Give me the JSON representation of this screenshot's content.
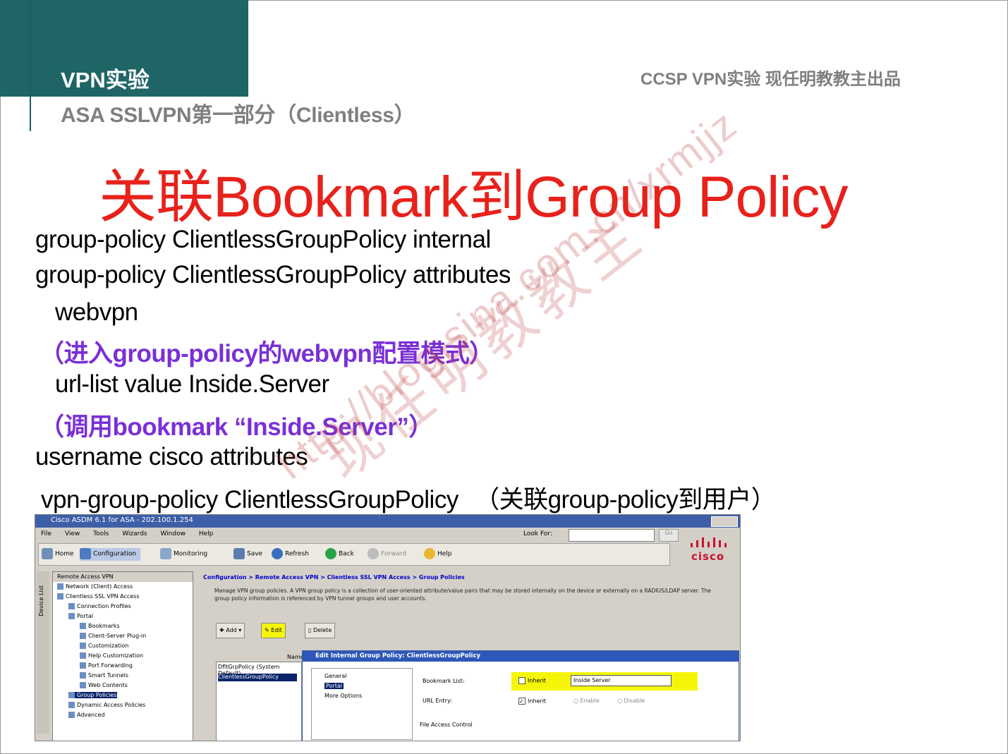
{
  "header": {
    "title": "VPN实验",
    "subtitle": "ASA SSLVPN第一部分（Clientless）",
    "right": "CCSP VPN实验  现任明教教主出品"
  },
  "main_title": "关联Bookmark到Group Policy",
  "lines": {
    "l1": "group-policy ClientlessGroupPolicy internal",
    "l2": "group-policy ClientlessGroupPolicy attributes",
    "l3": "webvpn",
    "l4": "（进入group-policy的webvpn配置模式）",
    "l5": "url-list value Inside.Server",
    "l6": "（调用bookmark “Inside.Server”）",
    "l7": "username cisco attributes",
    "l8a": "vpn-group-policy ClientlessGroupPolicy",
    "l8b": "（关联group-policy到用户）"
  },
  "watermark": {
    "url": "http://blog.sina.com.cn/xrmjjz",
    "cn": "现任明教教主"
  },
  "colors": {
    "header_bg": "#1f6566",
    "title_red": "#e8211b",
    "purple": "#7a2fd8",
    "highlight_yellow": "#f5f50a"
  },
  "asdm": {
    "window_title": "Cisco ASDM 6.1 for ASA - 202.100.1.254",
    "menu": [
      "File",
      "View",
      "Tools",
      "Wizards",
      "Window",
      "Help"
    ],
    "look_for_label": "Look For:",
    "go_label": "Go",
    "toolbar": {
      "home": "Home",
      "configuration": "Configuration",
      "monitoring": "Monitoring",
      "save": "Save",
      "refresh": "Refresh",
      "back": "Back",
      "forward": "Forward",
      "help": "Help"
    },
    "logo": "cisco",
    "left_bar_label": "Device List",
    "tree_header": "Remote Access VPN",
    "tree": [
      "Network (Client) Access",
      "Clientless SSL VPN Access",
      "Connection Profiles",
      "Portal",
      "Bookmarks",
      "Client-Server Plug-in",
      "Customization",
      "Help Customization",
      "Port Forwarding",
      "Smart Tunnels",
      "Web Contents",
      "Group Policies",
      "Dynamic Access Policies",
      "Advanced"
    ],
    "breadcrumb": "Configuration > Remote Access VPN > Clientless SSL VPN Access > Group Policies",
    "description": "Manage VPN group policies. A VPN group policy is a collection of user-oriented attribute/value pairs that may be stored internally on the device or externally on a RADIUS/LDAP server. The group policy information is referenced by VPN tunnel groups and user accounts.",
    "buttons": {
      "add": "Add",
      "edit": "Edit",
      "delete": "Delete"
    },
    "table": {
      "header": "Name",
      "col2": "DfltGrpPolicy (System Default)",
      "selected_row": "ClientlessGroupPolicy"
    },
    "dialog": {
      "title": "Edit Internal Group Policy: ClientlessGroupPolicy",
      "nav": [
        "General",
        "Portal",
        "More Options"
      ],
      "bookmark_list_label": "Bookmark List:",
      "inherit": "Inherit",
      "bookmark_value": "Inside Server",
      "url_entry_label": "URL Entry:",
      "enable": "Enable",
      "disable": "Disable",
      "file_access_label": "File Access Control"
    }
  }
}
